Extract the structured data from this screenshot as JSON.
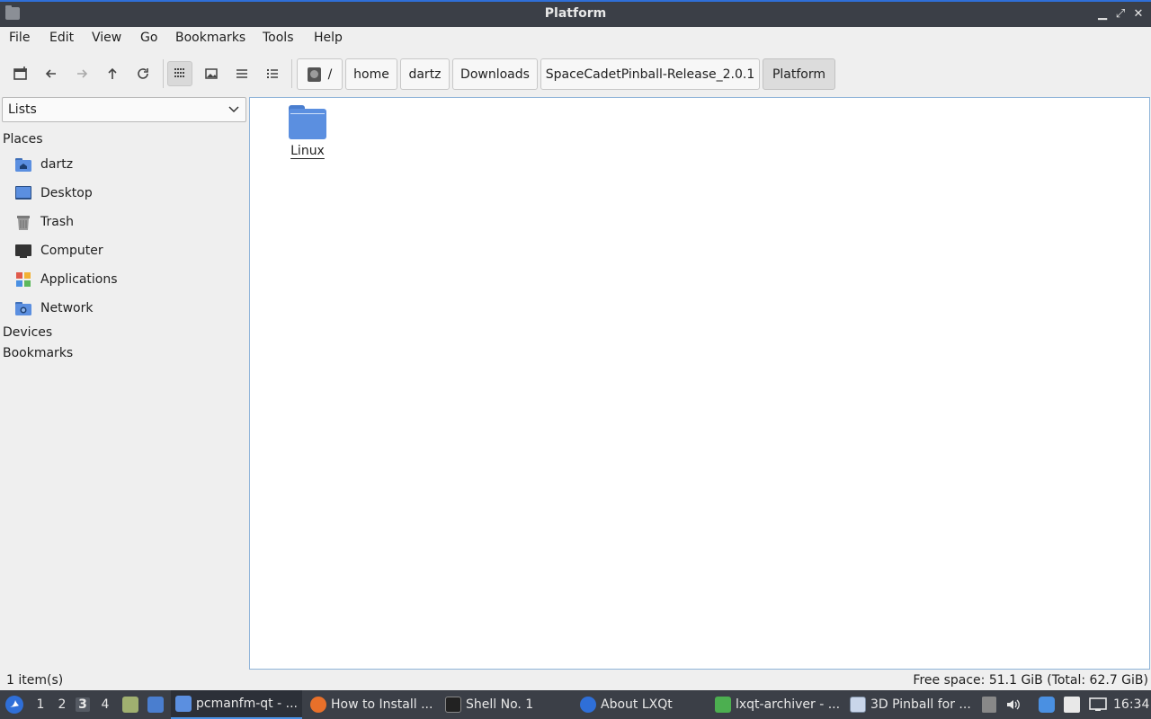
{
  "window": {
    "title": "Platform"
  },
  "menu": [
    "File",
    "Edit",
    "View",
    "Go",
    "Bookmarks",
    "Tools",
    "Help"
  ],
  "breadcrumb": [
    "/",
    "home",
    "dartz",
    "Downloads",
    "SpaceCadetPinball-Release_2.0.1",
    "Platform"
  ],
  "sidebar": {
    "view_mode": "Lists",
    "places_header": "Places",
    "places": [
      {
        "label": "dartz",
        "icon": "home-folder-icon"
      },
      {
        "label": "Desktop",
        "icon": "desktop-icon"
      },
      {
        "label": "Trash",
        "icon": "trash-icon"
      },
      {
        "label": "Computer",
        "icon": "computer-icon"
      },
      {
        "label": "Applications",
        "icon": "applications-icon"
      },
      {
        "label": "Network",
        "icon": "network-icon"
      }
    ],
    "devices_header": "Devices",
    "bookmarks_header": "Bookmarks"
  },
  "files": [
    {
      "name": "Linux",
      "icon": "folder-icon"
    }
  ],
  "status": {
    "count": "1 item(s)",
    "space": "Free space: 51.1 GiB (Total: 62.7 GiB)"
  },
  "taskbar": {
    "workspaces": [
      "1",
      "2",
      "3",
      "4"
    ],
    "current_workspace": "3",
    "tasks": [
      {
        "label": "pcmanfm-qt - ..."
      },
      {
        "label": "How to Install ..."
      },
      {
        "label": "Shell No. 1"
      },
      {
        "label": "About LXQt"
      },
      {
        "label": "lxqt-archiver - ..."
      },
      {
        "label": "3D Pinball for ..."
      }
    ],
    "clock": "16:34"
  },
  "colors": {
    "accent": "#2f6fd8",
    "folder": "#5b8fe0",
    "titlebar": "#3b3f47"
  }
}
